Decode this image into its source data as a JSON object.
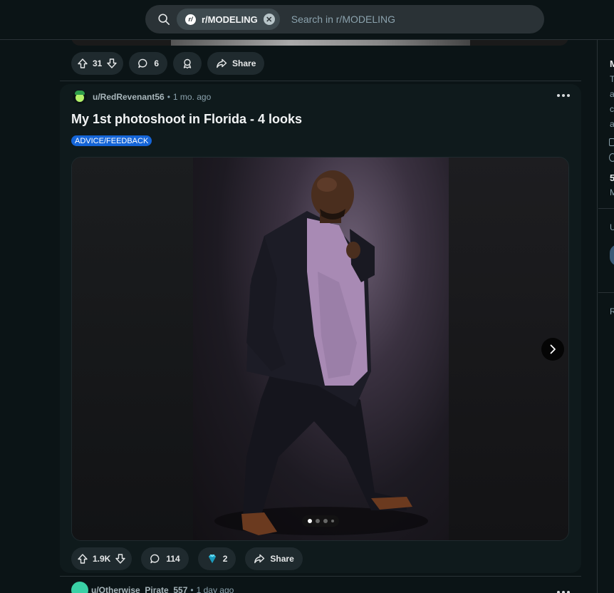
{
  "search": {
    "chip_icon": "r/",
    "chip_label": "r/MODELING",
    "placeholder": "Search in r/MODELING"
  },
  "prev_post": {
    "votes": "31",
    "comments": "6",
    "share_label": "Share"
  },
  "post": {
    "username": "u/RedRevenant56",
    "separator": "•",
    "time": "1 mo. ago",
    "title": "My 1st photoshoot in Florida - 4 looks",
    "flair": "ADVICE/FEEDBACK",
    "gallery_current": 1,
    "gallery_total": 4,
    "votes": "1.9K",
    "comments": "114",
    "awards": "2",
    "share_label": "Share"
  },
  "next_post": {
    "username": "u/Otherwise_Pirate_557",
    "separator": "•",
    "time": "1 day ago"
  },
  "sidebar": {
    "letters": [
      "M",
      "T",
      "a",
      "c",
      "a",
      "5",
      "M",
      "U",
      "R"
    ]
  },
  "colors": {
    "background": "#0b1416",
    "card": "#0f1a1c",
    "pill": "#1f2a2e",
    "flair": "#1565d8",
    "text": "#d7dadc",
    "muted": "#8ba2ad"
  },
  "icons": [
    "search-icon",
    "subreddit-icon",
    "close-icon",
    "upvote-icon",
    "downvote-icon",
    "comment-icon",
    "award-icon",
    "share-icon",
    "more-icon",
    "chevron-right-icon",
    "gem-icon"
  ]
}
